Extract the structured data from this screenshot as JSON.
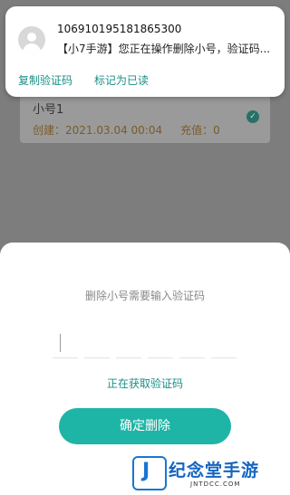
{
  "background": {
    "account_name": "小号1",
    "created_label": "创建：2021.03.04 00:04",
    "recharge_label": "充值：0"
  },
  "notification": {
    "sender": "106910195181865300",
    "message": "【小7手游】您正在操作删除小号，验证码...",
    "actions": [
      "复制验证码",
      "标记为已读"
    ]
  },
  "dialog": {
    "title": "删除小号需要输入验证码",
    "code_cells": 6,
    "status": "正在获取验证码",
    "confirm_label": "确定删除"
  },
  "watermark": {
    "name": "纪念堂手游",
    "domain": "JNTDCC.COM"
  },
  "colors": {
    "accent": "#1fb5a6",
    "accent_text": "#1a8f86",
    "overlay": "#7d7d7d"
  }
}
